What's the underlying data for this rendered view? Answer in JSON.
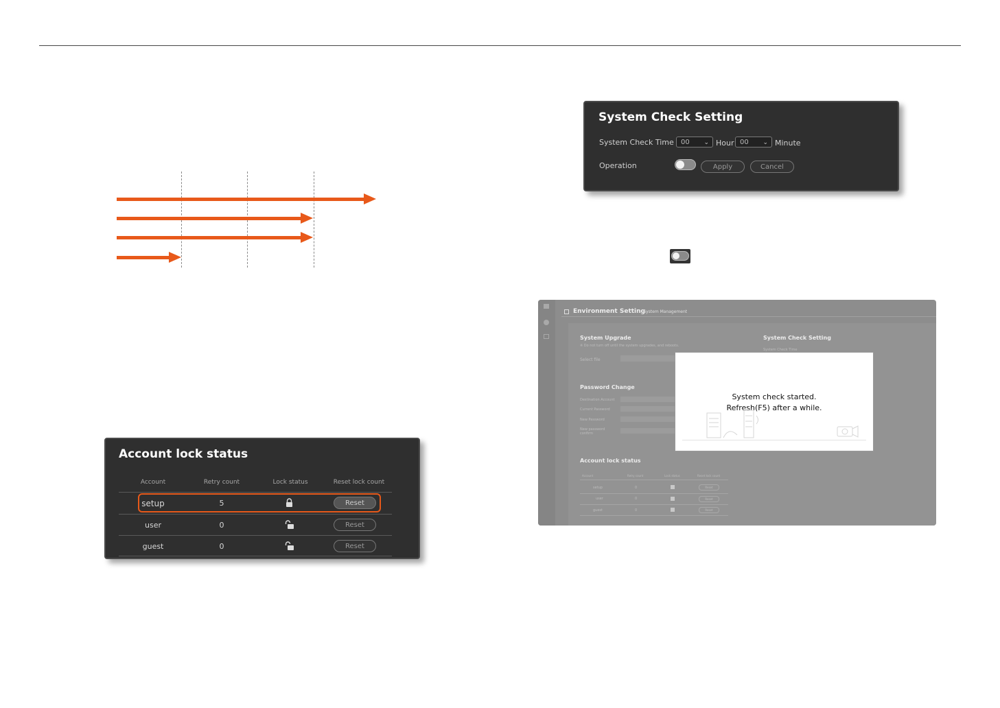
{
  "colors": {
    "accent": "#e8591a",
    "dialog_bg": "#2f2f2f",
    "page_bg": "#ffffff"
  },
  "system_check": {
    "title": "System Check Setting",
    "time_label": "System Check Time",
    "hour_value": "00",
    "hour_label": "Hour",
    "minute_value": "00",
    "minute_label": "Minute",
    "operation_label": "Operation",
    "operation_on": false,
    "apply_label": "Apply",
    "cancel_label": "Cancel"
  },
  "account_lock": {
    "title": "Account lock status",
    "columns": [
      "Account",
      "Retry count",
      "Lock status",
      "Reset lock count"
    ],
    "rows": [
      {
        "account": "setup",
        "retry": "5",
        "lock": "lock-closed-icon",
        "reset": "Reset",
        "highlighted": true
      },
      {
        "account": "user",
        "retry": "0",
        "lock": "lock-open-icon",
        "reset": "Reset",
        "highlighted": false
      },
      {
        "account": "guest",
        "retry": "0",
        "lock": "lock-open-icon",
        "reset": "Reset",
        "highlighted": false
      }
    ]
  },
  "screenshot": {
    "header_title": "Environment Setting",
    "header_sub": "System Management",
    "upgrade_title": "System Upgrade",
    "upgrade_note": "※ Do not turn off until the system upgrades, and reboots.",
    "select_file_label": "Select file",
    "system_check_title": "System Check Setting",
    "system_check_time_label": "System Check Time",
    "password_title": "Password Change",
    "password_fields": [
      "Destination Account",
      "Current Password",
      "New Password",
      "New password confirm"
    ],
    "account_title": "Account lock status",
    "account_columns": [
      "Account",
      "Retry count",
      "Lock status",
      "Reset lock count"
    ],
    "account_rows": [
      {
        "account": "setup",
        "retry": "0",
        "reset": "Reset"
      },
      {
        "account": "user",
        "retry": "0",
        "reset": "Reset"
      },
      {
        "account": "guest",
        "retry": "0",
        "reset": "Reset"
      }
    ],
    "popup_line1": "System check started.",
    "popup_line2": "Refresh(F5) after a while."
  }
}
